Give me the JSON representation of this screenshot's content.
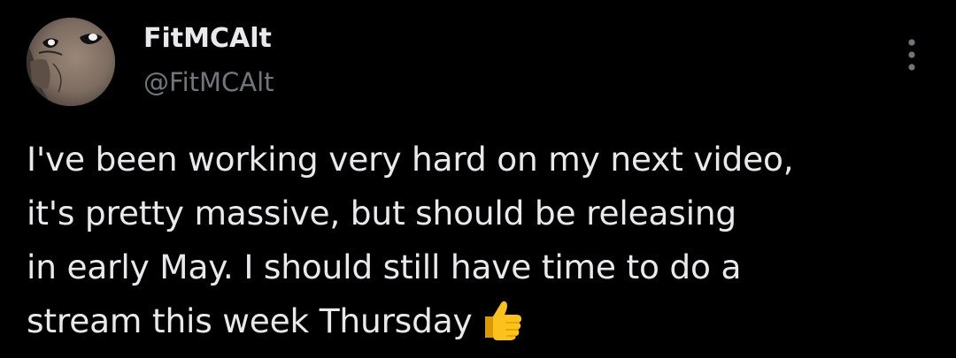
{
  "tweet": {
    "author": {
      "display_name": "FitMCAlt",
      "handle": "@FitMCAlt",
      "avatar_icon": "cartoon-face-avatar"
    },
    "more_icon": "vertical-ellipsis-icon",
    "text_lines": [
      "I've been working very hard on my next video,",
      "it's pretty massive, but should be releasing",
      "in early May. I should still have time to do a",
      "stream this week Thursday"
    ],
    "emoji": "thumbs-up-icon",
    "colors": {
      "background": "#000000",
      "primary_text": "#e7e9ea",
      "secondary_text": "#71767b",
      "emoji": "#f5b400"
    }
  }
}
